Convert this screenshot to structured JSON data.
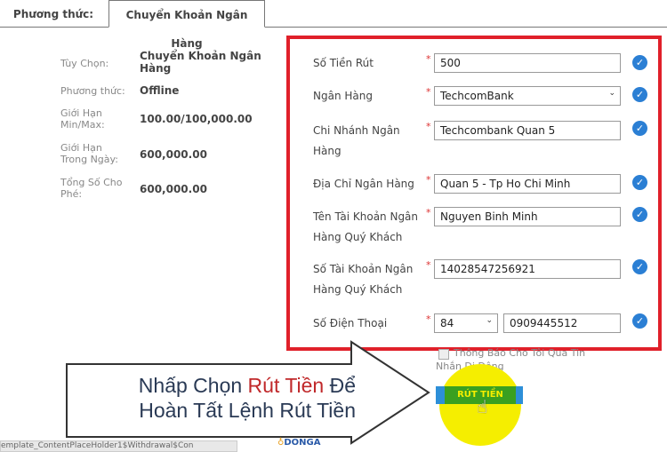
{
  "tabs": [
    {
      "label": "Phương thức:"
    },
    {
      "label": "Chuyển Khoản Ngân Hàng",
      "active": true
    }
  ],
  "info": [
    {
      "label": "Tùy Chọn:",
      "value": "Chuyển Khoản Ngân Hàng"
    },
    {
      "label": "Phương thức:",
      "value": "Offline"
    },
    {
      "label": "Giới Hạn Min/Max:",
      "value": "100.00/100,000.00"
    },
    {
      "label": "Giới Hạn Trong Ngày:",
      "value": "600,000.00"
    },
    {
      "label": "Tổng Số Cho Phé:",
      "value": "600,000.00"
    }
  ],
  "form": {
    "amount": {
      "label": "Số Tiền Rút",
      "value": "500"
    },
    "bank": {
      "label": "Ngân Hàng",
      "value": "TechcomBank"
    },
    "branch": {
      "label": "Chi Nhánh Ngân Hàng",
      "value": "Techcombank Quan 5"
    },
    "address": {
      "label": "Địa Chỉ Ngân Hàng",
      "value": "Quan 5 - Tp Ho Chi Minh"
    },
    "account_name": {
      "label": "Tên Tài Khoản Ngân Hàng Quý Khách",
      "value": "Nguyen Binh Minh"
    },
    "account_no": {
      "label": "Số Tài Khoản Ngân Hàng Quý Khách",
      "value": "14028547256921"
    },
    "phone": {
      "label": "Số Điện Thoại",
      "code": "84",
      "value": "0909445512"
    },
    "required_mark": "*",
    "sms_label": "Thông Báo Cho Tôi Qua Tin Nhắn Di Động",
    "submit_label": "RÚT TIỀN"
  },
  "callout": {
    "line1_a": "Nhấp Chọn ",
    "line1_highlight": "Rút Tiền",
    "line1_b": " Để",
    "line2": "Hoàn Tất Lệnh Rút Tiền"
  },
  "status_bar": "emplate_ContentPlaceHolder1$Withdrawal$Con",
  "logo_text": "DONGA",
  "colors": {
    "highlight_box": "#e0202a",
    "check": "#2b7fd4",
    "button": "#3aa020",
    "callout_red": "#c0282a",
    "cursor_halo": "#f5ee00"
  }
}
